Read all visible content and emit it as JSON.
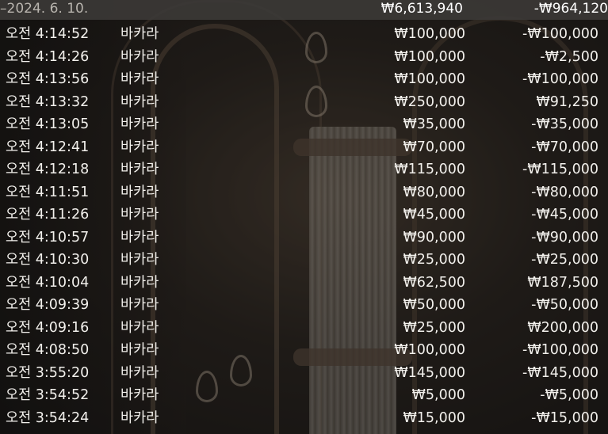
{
  "summary": {
    "date": "–2024. 6. 10.",
    "total_bet": "₩6,613,940",
    "total_result": "-₩964,120"
  },
  "rows": [
    {
      "time": "오전 4:14:52",
      "game": "바카라",
      "bet": "₩100,000",
      "result": "-₩100,000"
    },
    {
      "time": "오전 4:14:26",
      "game": "바카라",
      "bet": "₩100,000",
      "result": "-₩2,500"
    },
    {
      "time": "오전 4:13:56",
      "game": "바카라",
      "bet": "₩100,000",
      "result": "-₩100,000"
    },
    {
      "time": "오전 4:13:32",
      "game": "바카라",
      "bet": "₩250,000",
      "result": "₩91,250"
    },
    {
      "time": "오전 4:13:05",
      "game": "바카라",
      "bet": "₩35,000",
      "result": "-₩35,000"
    },
    {
      "time": "오전 4:12:41",
      "game": "바카라",
      "bet": "₩70,000",
      "result": "-₩70,000"
    },
    {
      "time": "오전 4:12:18",
      "game": "바카라",
      "bet": "₩115,000",
      "result": "-₩115,000"
    },
    {
      "time": "오전 4:11:51",
      "game": "바카라",
      "bet": "₩80,000",
      "result": "-₩80,000"
    },
    {
      "time": "오전 4:11:26",
      "game": "바카라",
      "bet": "₩45,000",
      "result": "-₩45,000"
    },
    {
      "time": "오전 4:10:57",
      "game": "바카라",
      "bet": "₩90,000",
      "result": "-₩90,000"
    },
    {
      "time": "오전 4:10:30",
      "game": "바카라",
      "bet": "₩25,000",
      "result": "-₩25,000"
    },
    {
      "time": "오전 4:10:04",
      "game": "바카라",
      "bet": "₩62,500",
      "result": "₩187,500"
    },
    {
      "time": "오전 4:09:39",
      "game": "바카라",
      "bet": "₩50,000",
      "result": "-₩50,000"
    },
    {
      "time": "오전 4:09:16",
      "game": "바카라",
      "bet": "₩25,000",
      "result": "₩200,000"
    },
    {
      "time": "오전 4:08:50",
      "game": "바카라",
      "bet": "₩100,000",
      "result": "-₩100,000"
    },
    {
      "time": "오전 3:55:20",
      "game": "바카라",
      "bet": "₩145,000",
      "result": "-₩145,000"
    },
    {
      "time": "오전 3:54:52",
      "game": "바카라",
      "bet": "₩5,000",
      "result": "-₩5,000"
    },
    {
      "time": "오전 3:54:24",
      "game": "바카라",
      "bet": "₩15,000",
      "result": "-₩15,000"
    }
  ]
}
